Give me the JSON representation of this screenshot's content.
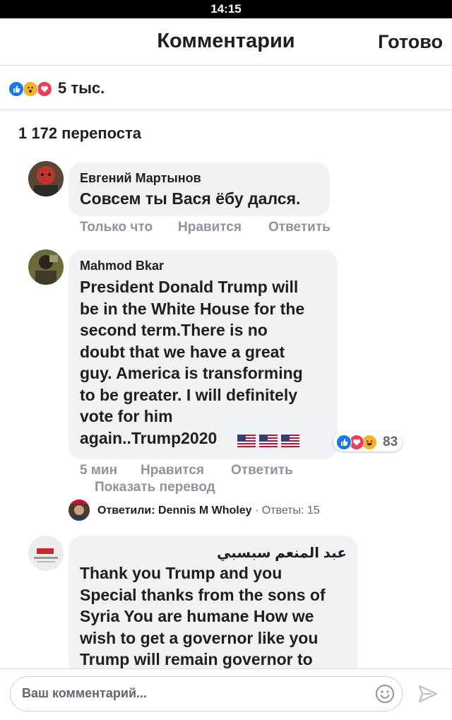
{
  "status_bar": {
    "time": "14:15"
  },
  "header": {
    "title": "Комментарии",
    "done_label": "Готово"
  },
  "reactions": {
    "count_label": "5 тыс.",
    "icons": [
      "like-icon",
      "wow-icon",
      "love-icon"
    ]
  },
  "shares_label": "1 172 перепоста",
  "comments": [
    {
      "author": "Евгений Мартынов",
      "text": "Совсем ты Вася ёбу дался.",
      "time": "Только что",
      "like_label": "Нравится",
      "reply_label": "Ответить"
    },
    {
      "author": "Mahmod Bkar",
      "text": "President Donald Trump will\nbe in the White House for the\nsecond term.There is no\ndoubt that we have a great\nguy. America is transforming\nto be greater. I will definitely\nvote for him\nagain..Trump2020",
      "flag_icons": [
        "us-flag-icon",
        "us-flag-icon",
        "us-flag-icon"
      ],
      "reaction_count": "83",
      "reaction_icons": [
        "like-icon",
        "love-icon",
        "haha-icon"
      ],
      "time": "5 мин",
      "like_label": "Нравится",
      "reply_label": "Ответить",
      "translate_label": "Показать перевод",
      "replies": {
        "prefix": "Ответили: Dennis M Wholey",
        "separator": " · ",
        "count_label": "Ответы: 15"
      }
    },
    {
      "author": "عبد المنعم سبسبي",
      "text": "Thank you Trump and you\nSpecial thanks from the sons of\nSyria You are humane How we\nwish to get a governor like you\nTrump will remain governor to"
    }
  ],
  "composer": {
    "placeholder": "Ваш комментарий..."
  },
  "colors": {
    "like_blue": "#1877f2",
    "love_red": "#f33e58",
    "meta_gray": "#8d949e",
    "bubble_bg": "#f0f2f5"
  }
}
